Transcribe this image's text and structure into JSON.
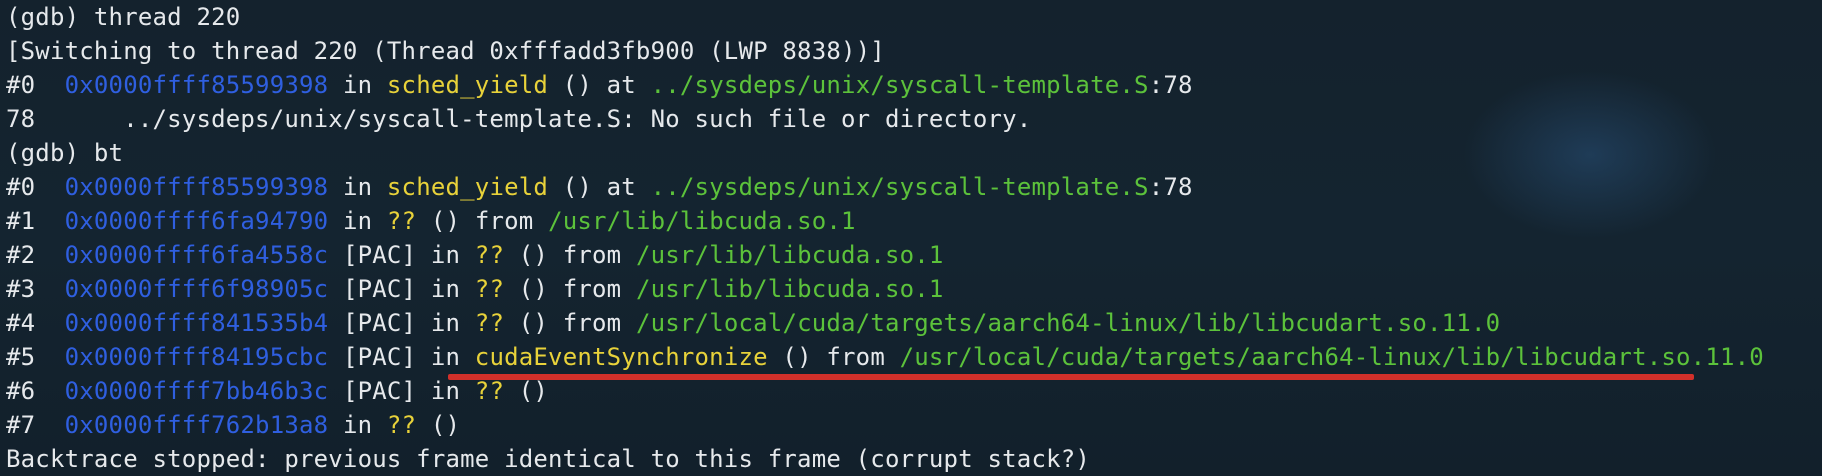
{
  "terminal": {
    "lines": [
      {
        "segments": [
          {
            "type": "plain",
            "text": "(gdb) thread 220"
          }
        ]
      },
      {
        "segments": [
          {
            "type": "plain",
            "text": "[Switching to thread 220 (Thread 0xfffadd3fb900 (LWP 8838))]"
          }
        ]
      },
      {
        "segments": [
          {
            "type": "plain",
            "text": "#0  "
          },
          {
            "type": "addr",
            "text": "0x0000ffff85599398"
          },
          {
            "type": "plain",
            "text": " in "
          },
          {
            "type": "func",
            "text": "sched_yield"
          },
          {
            "type": "plain",
            "text": " () at "
          },
          {
            "type": "path",
            "text": "../sysdeps/unix/syscall-template.S"
          },
          {
            "type": "plain",
            "text": ":78"
          }
        ]
      },
      {
        "segments": [
          {
            "type": "plain",
            "text": "78      ../sysdeps/unix/syscall-template.S: No such file or directory."
          }
        ]
      },
      {
        "segments": [
          {
            "type": "plain",
            "text": "(gdb) bt"
          }
        ]
      },
      {
        "segments": [
          {
            "type": "plain",
            "text": "#0  "
          },
          {
            "type": "addr",
            "text": "0x0000ffff85599398"
          },
          {
            "type": "plain",
            "text": " in "
          },
          {
            "type": "func",
            "text": "sched_yield"
          },
          {
            "type": "plain",
            "text": " () at "
          },
          {
            "type": "path",
            "text": "../sysdeps/unix/syscall-template.S"
          },
          {
            "type": "plain",
            "text": ":78"
          }
        ]
      },
      {
        "segments": [
          {
            "type": "plain",
            "text": "#1  "
          },
          {
            "type": "addr",
            "text": "0x0000ffff6fa94790"
          },
          {
            "type": "plain",
            "text": " in "
          },
          {
            "type": "func",
            "text": "??"
          },
          {
            "type": "plain",
            "text": " () from "
          },
          {
            "type": "path",
            "text": "/usr/lib/libcuda.so.1"
          }
        ]
      },
      {
        "segments": [
          {
            "type": "plain",
            "text": "#2  "
          },
          {
            "type": "addr",
            "text": "0x0000ffff6fa4558c"
          },
          {
            "type": "plain",
            "text": " [PAC] in "
          },
          {
            "type": "func",
            "text": "??"
          },
          {
            "type": "plain",
            "text": " () from "
          },
          {
            "type": "path",
            "text": "/usr/lib/libcuda.so.1"
          }
        ]
      },
      {
        "segments": [
          {
            "type": "plain",
            "text": "#3  "
          },
          {
            "type": "addr",
            "text": "0x0000ffff6f98905c"
          },
          {
            "type": "plain",
            "text": " [PAC] in "
          },
          {
            "type": "func",
            "text": "??"
          },
          {
            "type": "plain",
            "text": " () from "
          },
          {
            "type": "path",
            "text": "/usr/lib/libcuda.so.1"
          }
        ]
      },
      {
        "segments": [
          {
            "type": "plain",
            "text": "#4  "
          },
          {
            "type": "addr",
            "text": "0x0000ffff841535b4"
          },
          {
            "type": "plain",
            "text": " [PAC] in "
          },
          {
            "type": "func",
            "text": "??"
          },
          {
            "type": "plain",
            "text": " () from "
          },
          {
            "type": "path",
            "text": "/usr/local/cuda/targets/aarch64-linux/lib/libcudart.so.11.0"
          }
        ]
      },
      {
        "segments": [
          {
            "type": "plain",
            "text": "#5  "
          },
          {
            "type": "addr",
            "text": "0x0000ffff84195cbc"
          },
          {
            "type": "plain",
            "text": " [PAC] in "
          },
          {
            "type": "func",
            "text": "cudaEventSynchronize"
          },
          {
            "type": "plain",
            "text": " () from "
          },
          {
            "type": "path",
            "text": "/usr/local/cuda/targets/aarch64-linux/lib/libcudart.so.11.0"
          }
        ]
      },
      {
        "segments": [
          {
            "type": "plain",
            "text": "#6  "
          },
          {
            "type": "addr",
            "text": "0x0000ffff7bb46b3c"
          },
          {
            "type": "plain",
            "text": " [PAC] in "
          },
          {
            "type": "func",
            "text": "??"
          },
          {
            "type": "plain",
            "text": " ()"
          }
        ]
      },
      {
        "segments": [
          {
            "type": "plain",
            "text": "#7  "
          },
          {
            "type": "addr",
            "text": "0x0000ffff762b13a8"
          },
          {
            "type": "plain",
            "text": " in "
          },
          {
            "type": "func",
            "text": "??"
          },
          {
            "type": "plain",
            "text": " ()"
          }
        ]
      },
      {
        "segments": [
          {
            "type": "plain",
            "text": "Backtrace stopped: previous frame identical to this frame (corrupt stack?)"
          }
        ]
      }
    ]
  },
  "colors": {
    "background": "#142430",
    "text": "#e6e9ec",
    "address": "#2f5fe0",
    "function": "#e8d23a",
    "path": "#5cc23b",
    "highlight_underline": "#d2302a"
  }
}
